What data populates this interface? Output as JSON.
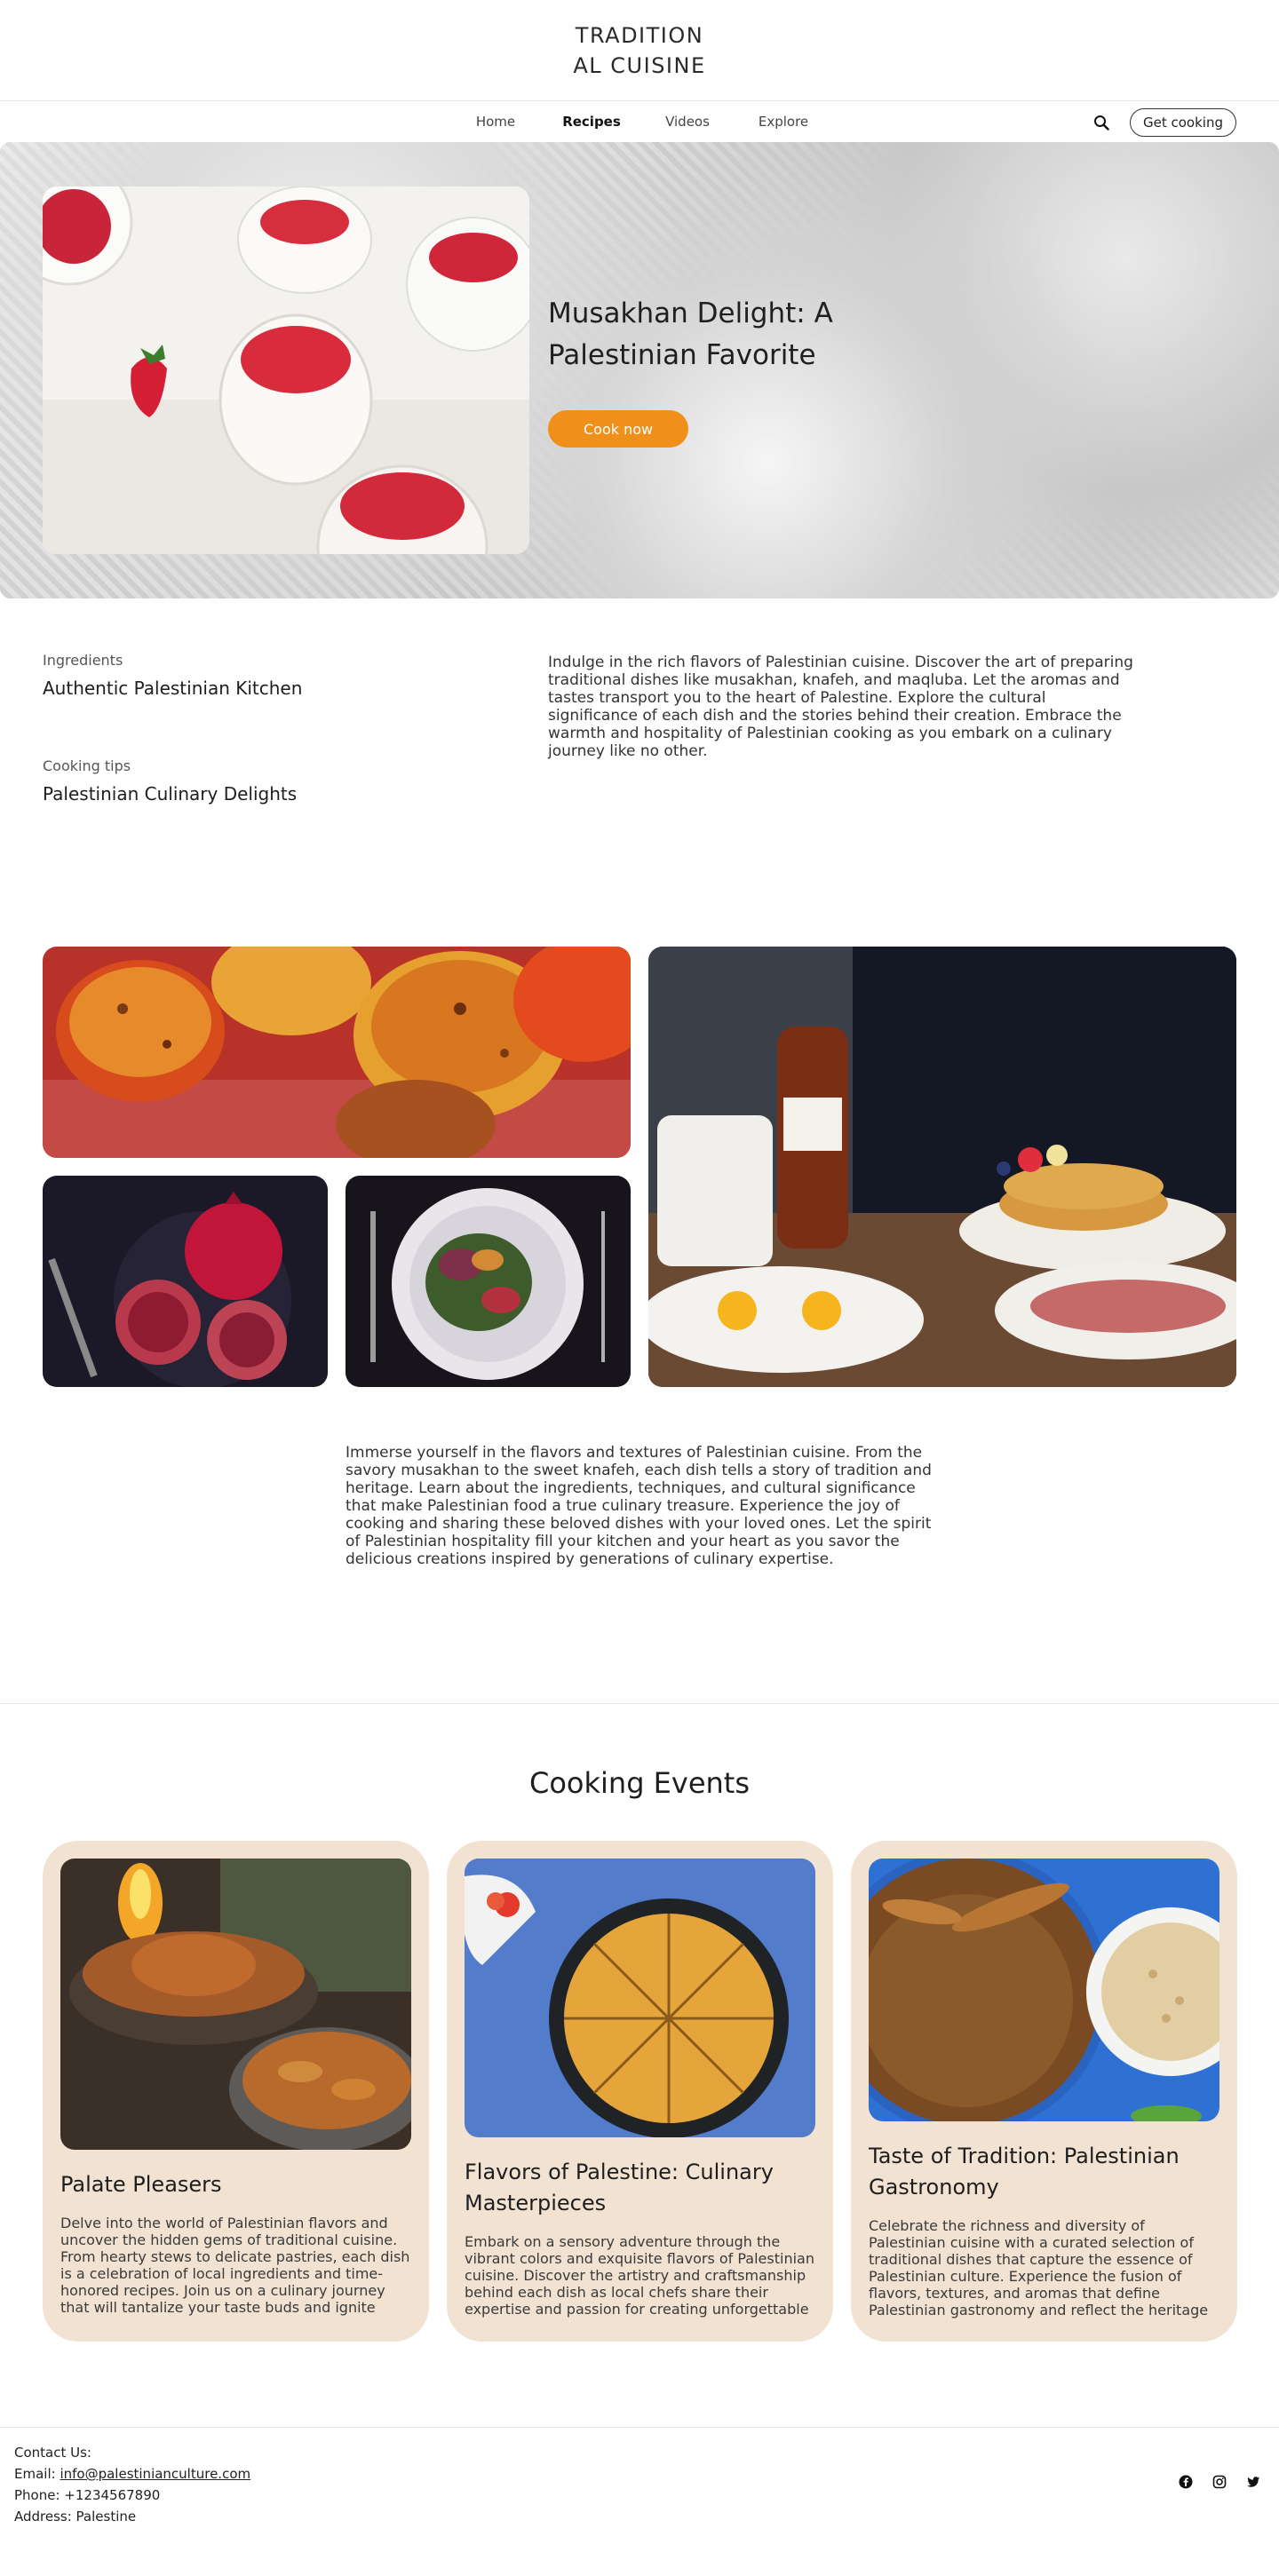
{
  "brand": {
    "name": "TRADITIONAL CUISINE"
  },
  "nav": {
    "links": [
      "Home",
      "Recipes",
      "Videos",
      "Explore"
    ],
    "active": "Recipes",
    "cta": "Get cooking"
  },
  "hero": {
    "title": "Musakhan Delight: A Palestinian Favorite",
    "button": "Cook now"
  },
  "intro": {
    "items": [
      {
        "label": "Ingredients",
        "title": "Authentic Palestinian Kitchen"
      },
      {
        "label": "Cooking tips",
        "title": "Palestinian Culinary Delights"
      }
    ],
    "description": "Indulge in the rich flavors of Palestinian cuisine. Discover the art of preparing traditional dishes like musakhan, knafeh, and maqluba. Let the aromas and tastes transport you to the heart of Palestine. Explore the cultural significance of each dish and the stories behind their creation. Embrace the warmth and hospitality of Palestinian cooking as you embark on a culinary journey like no other."
  },
  "story": {
    "text": "Immerse yourself in the flavors and textures of Palestinian cuisine. From the savory musakhan to the sweet knafeh, each dish tells a story of tradition and heritage. Learn about the ingredients, techniques, and cultural significance that make Palestinian food a true culinary treasure. Experience the joy of cooking and sharing these beloved dishes with your loved ones. Let the spirit of Palestinian hospitality fill your kitchen and your heart as you savor the delicious creations inspired by generations of culinary expertise."
  },
  "events": {
    "heading": "Cooking Events",
    "cards": [
      {
        "title": "Palate Pleasers",
        "text": "Delve into the world of Palestinian flavors and uncover the hidden gems of traditional cuisine. From hearty stews to delicate pastries, each dish is a celebration of local ingredients and time-honored recipes. Join us on a culinary journey that will tantalize your taste buds and ignite your"
      },
      {
        "title": "Flavors of Palestine: Culinary Masterpieces",
        "text": "Embark on a sensory adventure through the vibrant colors and exquisite flavors of Palestinian cuisine. Discover the artistry and craftsmanship behind each dish as local chefs share their expertise and passion for creating unforgettable"
      },
      {
        "title": "Taste of Tradition: Palestinian Gastronomy",
        "text": "Celebrate the richness and diversity of Palestinian cuisine with a curated selection of traditional dishes that capture the essence of Palestinian culture. Experience the fusion of flavors, textures, and aromas that define Palestinian gastronomy and reflect the heritage"
      }
    ]
  },
  "footer": {
    "contact_label": "Contact Us:",
    "email_label": "Email: ",
    "email": "info@palestinianculture.com",
    "phone": "Phone: +1234567890",
    "address": "Address: Palestine",
    "social_icons": [
      "facebook-icon",
      "instagram-icon",
      "twitter-icon"
    ]
  },
  "colors": {
    "accent": "#f0901b",
    "card_bg": "#f2e2d2"
  }
}
